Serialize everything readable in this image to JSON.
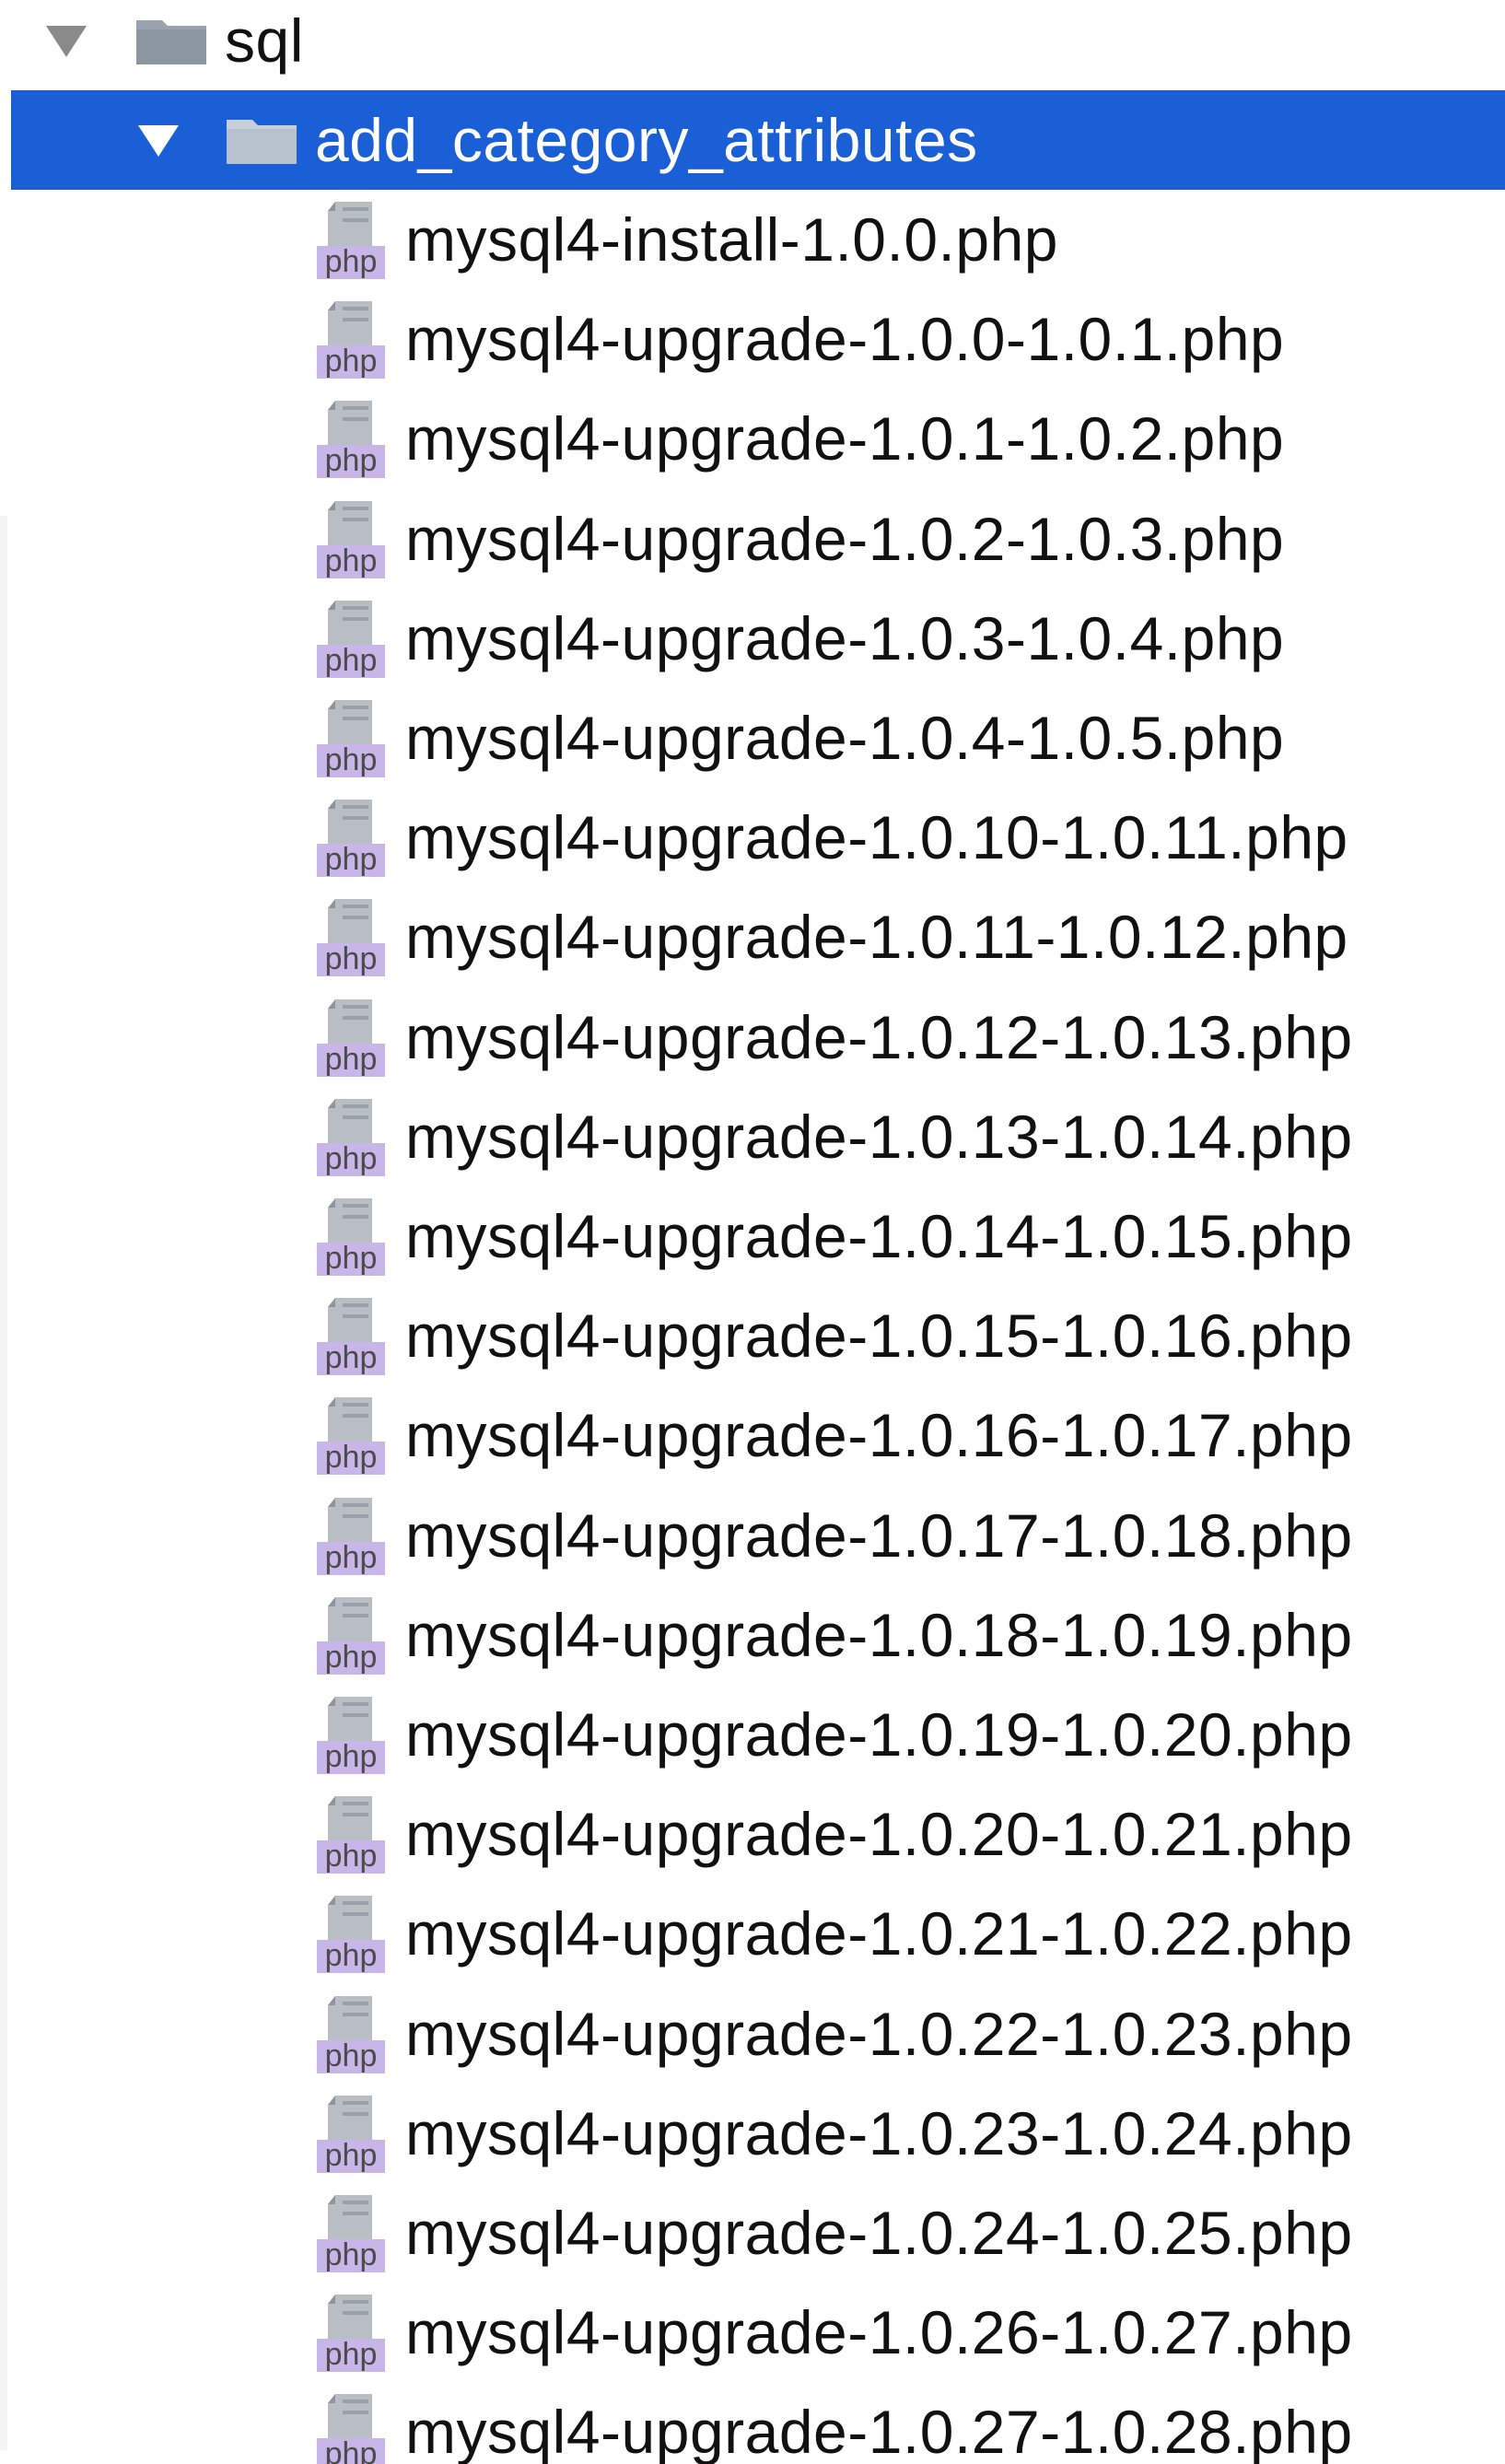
{
  "tree": {
    "root_folder": {
      "label": "sql",
      "icon": "folder-icon",
      "expanded": true
    },
    "selected_folder": {
      "label": "add_category_attributes",
      "icon": "folder-icon",
      "expanded": true,
      "selection_color": "#1a5fd6"
    },
    "file_icon": {
      "name": "php-file-icon",
      "badge_text": "php",
      "badge_color": "#c9b6e8"
    },
    "files": [
      "mysql4-install-1.0.0.php",
      "mysql4-upgrade-1.0.0-1.0.1.php",
      "mysql4-upgrade-1.0.1-1.0.2.php",
      "mysql4-upgrade-1.0.2-1.0.3.php",
      "mysql4-upgrade-1.0.3-1.0.4.php",
      "mysql4-upgrade-1.0.4-1.0.5.php",
      "mysql4-upgrade-1.0.10-1.0.11.php",
      "mysql4-upgrade-1.0.11-1.0.12.php",
      "mysql4-upgrade-1.0.12-1.0.13.php",
      "mysql4-upgrade-1.0.13-1.0.14.php",
      "mysql4-upgrade-1.0.14-1.0.15.php",
      "mysql4-upgrade-1.0.15-1.0.16.php",
      "mysql4-upgrade-1.0.16-1.0.17.php",
      "mysql4-upgrade-1.0.17-1.0.18.php",
      "mysql4-upgrade-1.0.18-1.0.19.php",
      "mysql4-upgrade-1.0.19-1.0.20.php",
      "mysql4-upgrade-1.0.20-1.0.21.php",
      "mysql4-upgrade-1.0.21-1.0.22.php",
      "mysql4-upgrade-1.0.22-1.0.23.php",
      "mysql4-upgrade-1.0.23-1.0.24.php",
      "mysql4-upgrade-1.0.24-1.0.25.php",
      "mysql4-upgrade-1.0.26-1.0.27.php",
      "mysql4-upgrade-1.0.27-1.0.28.php"
    ]
  }
}
